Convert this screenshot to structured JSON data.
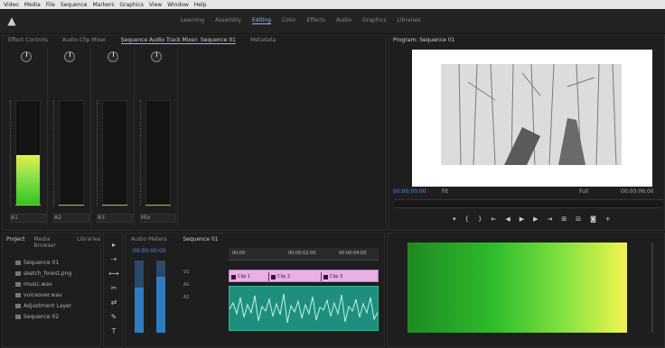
{
  "menubar": {
    "items": [
      "Video",
      "Media",
      "File",
      "Sequence",
      "Markers",
      "Graphics",
      "View",
      "Window",
      "Help"
    ]
  },
  "header": {
    "workspaces": [
      "Learning",
      "Assembly",
      "Editing",
      "Color",
      "Effects",
      "Audio",
      "Graphics",
      "Libraries"
    ],
    "active_workspace_index": 2
  },
  "mixer": {
    "tabs": [
      "Effect Controls",
      "Audio Clip Mixer",
      "Sequence Audio Track Mixer: Sequence 01",
      "Metadata"
    ],
    "active_tab_index": 2,
    "strips": [
      {
        "label": "A1",
        "level": 0.48
      },
      {
        "label": "A2",
        "level": 0.0
      },
      {
        "label": "A3",
        "level": 0.0
      },
      {
        "label": "Mix",
        "level": 0.0
      }
    ]
  },
  "program": {
    "title": "Program: Sequence 01",
    "timecode": "00:00:00:00",
    "fit": "Fit",
    "quality": "Full",
    "duration": "00:00:06:00"
  },
  "project": {
    "tabs": [
      "Project",
      "Media Browser",
      "Libraries"
    ],
    "items": [
      "Sequence 01",
      "sketch_forest.png",
      "music.wav",
      "voiceover.wav",
      "Adjustment Layer",
      "Sequence 02"
    ]
  },
  "timeline": {
    "tabs": [
      "Audio Meters",
      "Sequence 01"
    ],
    "timecode": "00:00:00:00",
    "ruler": [
      "00:00",
      "00:00:02:00",
      "00:00:04:00"
    ],
    "clips": [
      "Clip 1",
      "Clip 2",
      "Clip 3"
    ],
    "track_labels": [
      "V1",
      "A1",
      "A2"
    ],
    "vu_levels": [
      0.62,
      0.78
    ]
  },
  "meters": {
    "level": 0.95
  }
}
